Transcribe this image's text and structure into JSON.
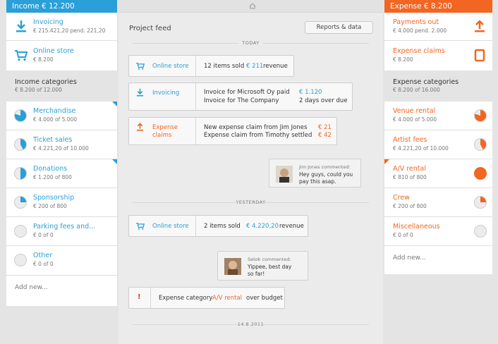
{
  "income": {
    "header": "Income € 12.200",
    "invoicing": {
      "label": "Invoicing",
      "sub": "€ 215.421,20 pend. 221,20"
    },
    "online_store": {
      "label": "Online store",
      "sub": "€ 8.200"
    },
    "categories_title": "Income categories",
    "categories_sub": "€ 8.200 of 12.000",
    "categories": [
      {
        "label": "Merchandise",
        "sub": "€ 4.000 of 5.000",
        "fill": 0.8
      },
      {
        "label": "Ticket sales",
        "sub": "€ 4.221,20 of 10.000",
        "fill": 0.42
      },
      {
        "label": "Donations",
        "sub": "€ 1.200 of 800",
        "fill": 0.5
      },
      {
        "label": "Sponsorship",
        "sub": "€ 200 of 800",
        "fill": 0.25
      },
      {
        "label": "Parking fees and...",
        "sub": "€ 0 of 0",
        "fill": 0
      },
      {
        "label": "Other",
        "sub": "€ 0 of 0",
        "fill": 0
      }
    ],
    "add_new": "Add new..."
  },
  "expense": {
    "header": "Expense € 8.200",
    "payments_out": {
      "label": "Payments out",
      "sub": "€ 4.000 pend. 2.000"
    },
    "expense_claims": {
      "label": "Expense claims",
      "sub": "€ 8.200"
    },
    "categories_title": "Expense categories",
    "categories_sub": "€ 8.200 of 16.000",
    "categories": [
      {
        "label": "Venue rental",
        "sub": "€ 4.000 of 5.000",
        "fill": 0.8
      },
      {
        "label": "Artist fees",
        "sub": "€ 4.221,20 of 10.000",
        "fill": 0.42
      },
      {
        "label": "A/V rental",
        "sub": "€ 810 of 800",
        "fill": 1
      },
      {
        "label": "Crew",
        "sub": "€ 200 of 800",
        "fill": 0.25
      },
      {
        "label": "Miscellaneous",
        "sub": "€ 0 of 0",
        "fill": 0
      }
    ],
    "add_new": "Add new..."
  },
  "feed": {
    "title": "Project feed",
    "reports_button": "Reports & data",
    "today": "TODAY",
    "yesterday": "YESTERDAY",
    "date_label": "14.8.2011",
    "items": {
      "store_today": {
        "label": "Online store",
        "text": "12 items sold",
        "value": "€ 211",
        "suffix": "revenue"
      },
      "invoicing": {
        "label": "Invoicing",
        "line1": "Invoice for Microsoft Oy paid",
        "val1": "€ 1.120",
        "line2": "Invoice for The Company",
        "val2": "2 days over due"
      },
      "claims": {
        "label1": "Expense",
        "label2": "claims",
        "line1": "New expense claim from Jim Jones",
        "val1": "€ 21",
        "line2": "Expense claim from Timothy settled",
        "val2": "€ 42"
      },
      "comment1": {
        "who": "Jim Jones commented:",
        "msg1": "Hey guys, could you",
        "msg2": "pay this asap."
      },
      "store_yesterday": {
        "label": "Online store",
        "text": "2 items sold",
        "value": "€ 4.220,20",
        "suffix": "revenue"
      },
      "comment2": {
        "who": "Setok commented:",
        "msg1": "Yippee, best day",
        "msg2": "so far!"
      },
      "budget": {
        "icon": "!",
        "prefix": "Expense category",
        "highlight": "A/V rental",
        "suffix": "over budget"
      }
    }
  },
  "colors": {
    "income": "#2a9fd8",
    "expense": "#f26522"
  }
}
